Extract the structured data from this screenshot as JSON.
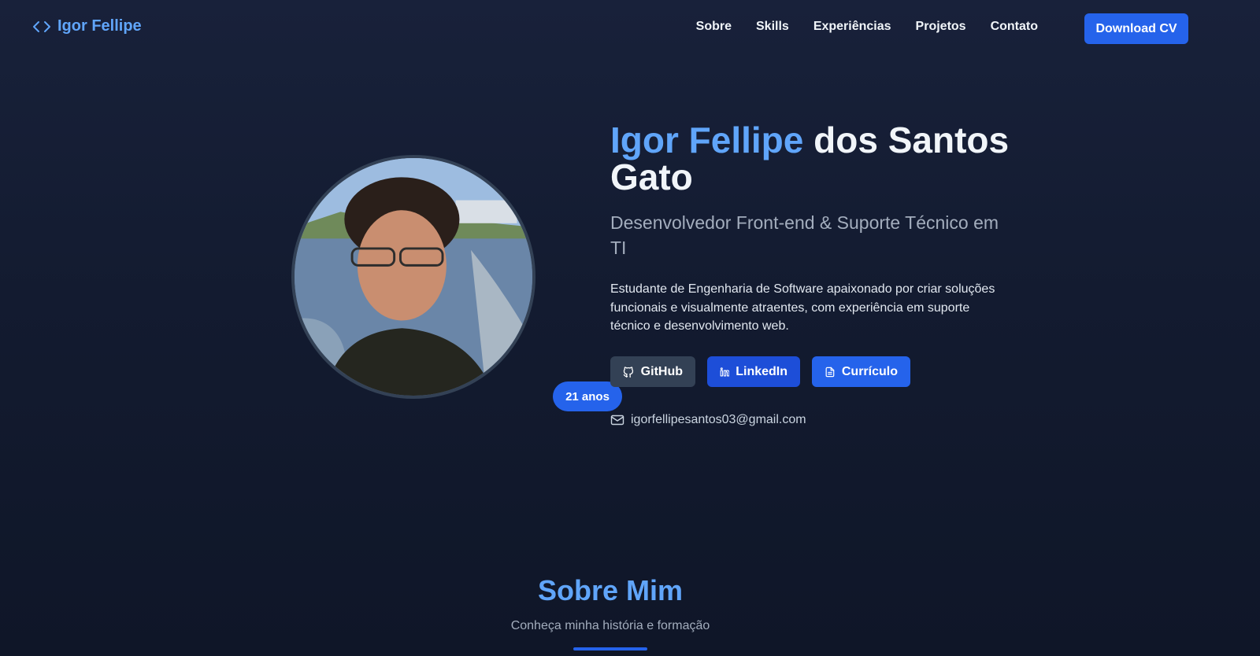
{
  "header": {
    "logo_text": "Igor Fellipe",
    "logo_icon": "code-brackets-icon",
    "nav": [
      {
        "label": "Sobre"
      },
      {
        "label": "Skills"
      },
      {
        "label": "Experiências"
      },
      {
        "label": "Projetos"
      },
      {
        "label": "Contato"
      }
    ],
    "download_label": "Download CV"
  },
  "hero": {
    "name_first": "Igor Fellipe",
    "name_rest": "dos Santos Gato",
    "role": "Desenvolvedor Front-end & Suporte Técnico em TI",
    "bio": "Estudante de Engenharia de Software apaixonado por criar soluções funcionais e visualmente atraentes, com experiência em suporte técnico e desenvolvimento web.",
    "age_badge": "21 anos",
    "buttons": {
      "github": "GitHub",
      "linkedin": "LinkedIn",
      "cv": "Currículo"
    },
    "email": "igorfellipesantos03@gmail.com"
  },
  "about": {
    "title": "Sobre Mim",
    "subtitle": "Conheça minha história e formação"
  },
  "colors": {
    "accent": "#60a5fa",
    "primary_button": "#2563eb",
    "background": "#131b30"
  }
}
